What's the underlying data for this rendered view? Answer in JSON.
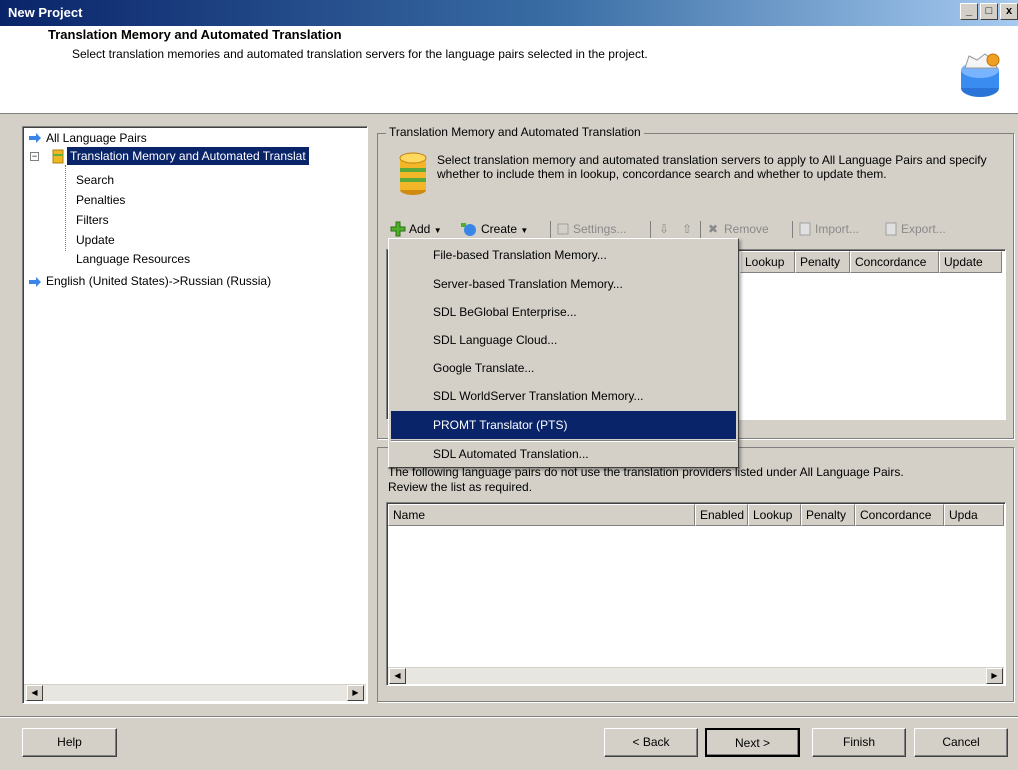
{
  "window": {
    "title": "New Project"
  },
  "header": {
    "title": "Translation Memory and Automated Translation",
    "subtitle": "Select translation memories and automated translation servers for the language pairs selected in the project."
  },
  "tree": {
    "items": [
      {
        "label": "All Language Pairs"
      },
      {
        "label": "Translation Memory and Automated Translat",
        "selected": true
      },
      {
        "label": "Search"
      },
      {
        "label": "Penalties"
      },
      {
        "label": "Filters"
      },
      {
        "label": "Update"
      },
      {
        "label": "Language Resources"
      },
      {
        "label": "English (United States)->Russian (Russia)"
      }
    ]
  },
  "group_tm": {
    "label": "Translation Memory and Automated Translation",
    "description": "Select translation memory and automated translation servers to apply to All Language Pairs and specify whether to include them in lookup, concordance search and whether to update them."
  },
  "toolbar": {
    "add": "Add",
    "create": "Create",
    "settings": "Settings...",
    "remove": "Remove",
    "import": "Import...",
    "export": "Export..."
  },
  "tm_list": {
    "columns": [
      "Lookup",
      "Penalty",
      "Concordance",
      "Update"
    ]
  },
  "menu": {
    "items": [
      "File-based Translation Memory...",
      "Server-based Translation Memory...",
      "SDL BeGlobal Enterprise...",
      "SDL Language Cloud...",
      "Google Translate...",
      "SDL WorldServer Translation Memory...",
      "PROMT Translator (PTS)",
      "SDL Automated Translation..."
    ],
    "highlighted": "PROMT Translator (PTS)"
  },
  "group_pairs": {
    "text_line1": "The following language pairs do not use the translation providers listed under All Language Pairs.",
    "text_line2": "Review the list as required.",
    "columns": [
      "Name",
      "Enabled",
      "Lookup",
      "Penalty",
      "Concordance",
      "Upda"
    ]
  },
  "buttons": {
    "help": "Help",
    "back": "< Back",
    "next": "Next >",
    "finish": "Finish",
    "cancel": "Cancel"
  },
  "colors": {
    "selection": "#0a246a",
    "window_face": "#d4d0c8",
    "titlebar_start": "#0a246a",
    "titlebar_end": "#a6caf0"
  }
}
